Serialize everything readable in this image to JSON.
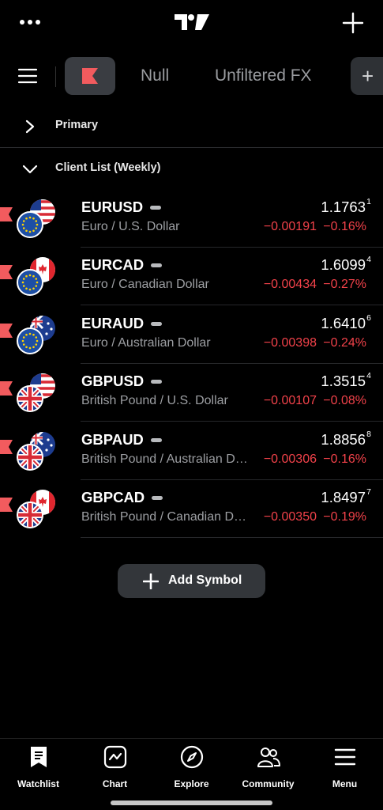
{
  "colors": {
    "negative": "#f2424a",
    "accent_flag": "#f25b5e",
    "background": "#000000"
  },
  "topbar": {
    "more_icon": "more-dots-icon",
    "logo_icon": "tradingview-logo-icon",
    "add_icon": "plus-icon"
  },
  "tabs": {
    "menu_icon": "hamburger-icon",
    "flag_icon": "red-flag-icon",
    "items": [
      "Null",
      "Unfiltered FX"
    ],
    "add_label": "+"
  },
  "sections": {
    "primary": {
      "label": "Primary",
      "expanded": false
    },
    "client": {
      "label": "Client List (Weekly)",
      "expanded": true
    }
  },
  "rows": [
    {
      "symbol": "EURUSD",
      "desc": "Euro / U.S. Dollar",
      "price": "1.1763",
      "sup": "1",
      "change": "−0.00191",
      "pct": "−0.16%"
    },
    {
      "symbol": "EURCAD",
      "desc": "Euro / Canadian Dollar",
      "price": "1.6099",
      "sup": "4",
      "change": "−0.00434",
      "pct": "−0.27%"
    },
    {
      "symbol": "EURAUD",
      "desc": "Euro / Australian Dollar",
      "price": "1.6410",
      "sup": "6",
      "change": "−0.00398",
      "pct": "−0.24%"
    },
    {
      "symbol": "GBPUSD",
      "desc": "British Pound / U.S. Dollar",
      "price": "1.3515",
      "sup": "4",
      "change": "−0.00107",
      "pct": "−0.08%"
    },
    {
      "symbol": "GBPAUD",
      "desc": "British Pound / Australian D…",
      "price": "1.8856",
      "sup": "8",
      "change": "−0.00306",
      "pct": "−0.16%"
    },
    {
      "symbol": "GBPCAD",
      "desc": "British Pound / Canadian D…",
      "price": "1.8497",
      "sup": "7",
      "change": "−0.00350",
      "pct": "−0.19%"
    }
  ],
  "add_symbol": {
    "label": "Add Symbol",
    "icon": "plus-icon"
  },
  "bottom_nav": [
    {
      "label": "Watchlist",
      "icon": "watchlist-icon",
      "active": true
    },
    {
      "label": "Chart",
      "icon": "chart-icon"
    },
    {
      "label": "Explore",
      "icon": "compass-icon"
    },
    {
      "label": "Community",
      "icon": "community-icon"
    },
    {
      "label": "Menu",
      "icon": "menu-icon"
    }
  ]
}
